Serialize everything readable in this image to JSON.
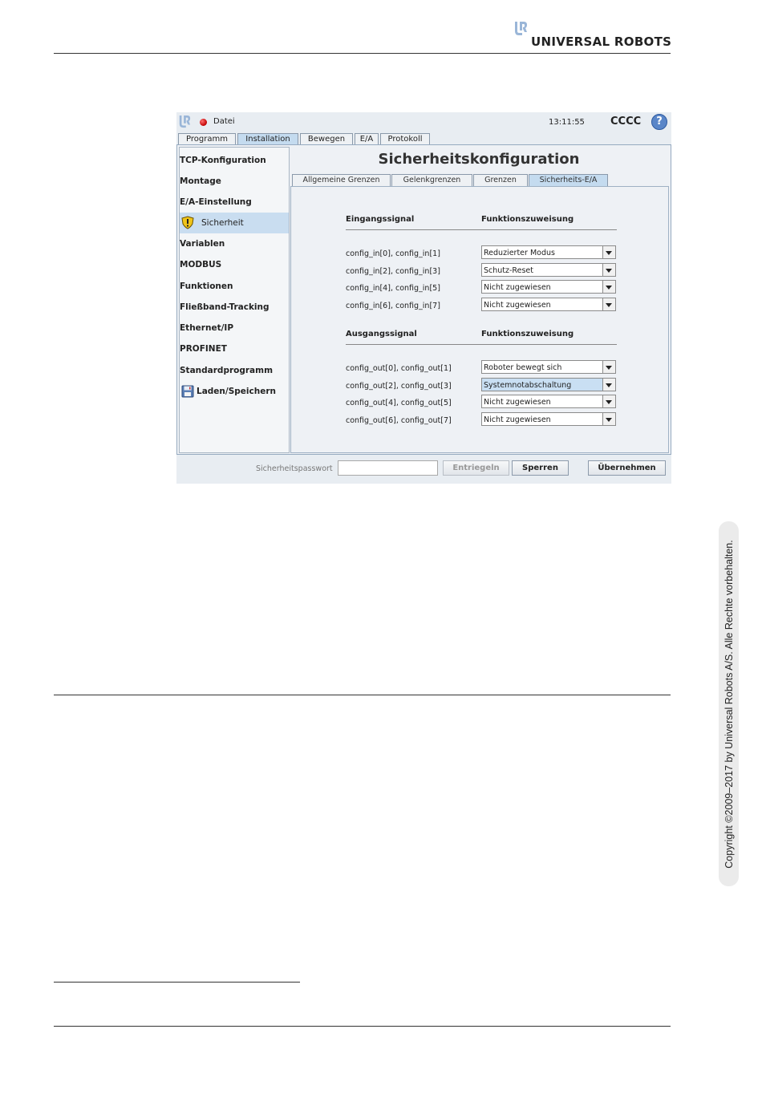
{
  "header": {
    "brand": "UNIVERSAL ROBOTS"
  },
  "copyright": "Copyright ©2009–2017 by Universal Robots A/S. Alle Rechte vorbehalten.",
  "app": {
    "topbar": {
      "file_menu": "Datei",
      "time": "13:11:55",
      "robot_name": "CCCC",
      "help_icon": "?"
    },
    "main_tabs": [
      {
        "label": "Programm",
        "active": false
      },
      {
        "label": "Installation",
        "active": true
      },
      {
        "label": "Bewegen",
        "active": false
      },
      {
        "label": "E/A",
        "active": false
      },
      {
        "label": "Protokoll",
        "active": false
      }
    ],
    "sidebar": [
      {
        "label": "TCP-Konfiguration"
      },
      {
        "label": "Montage"
      },
      {
        "label": "E/A-Einstellung"
      },
      {
        "label": "Sicherheit",
        "icon": "warning-shield-icon",
        "selected": true
      },
      {
        "label": "Variablen"
      },
      {
        "label": "MODBUS"
      },
      {
        "label": "Funktionen"
      },
      {
        "label": "Fließband-Tracking"
      },
      {
        "label": "Ethernet/IP"
      },
      {
        "label": "PROFINET"
      },
      {
        "label": "Standardprogramm"
      },
      {
        "label": "Laden/Speichern",
        "icon": "save-disk-icon"
      }
    ],
    "page_title": "Sicherheitskonfiguration",
    "sub_tabs": [
      {
        "label": "Allgemeine Grenzen",
        "active": false
      },
      {
        "label": "Gelenkgrenzen",
        "active": false
      },
      {
        "label": "Grenzen",
        "active": false
      },
      {
        "label": "Sicherheits-E/A",
        "active": true
      }
    ],
    "inputs": {
      "header_signal": "Eingangssignal",
      "header_function": "Funktionszuweisung",
      "rows": [
        {
          "signal": "config_in[0], config_in[1]",
          "value": "Reduzierter Modus",
          "highlighted": false
        },
        {
          "signal": "config_in[2], config_in[3]",
          "value": "Schutz-Reset",
          "highlighted": false
        },
        {
          "signal": "config_in[4], config_in[5]",
          "value": "Nicht zugewiesen",
          "highlighted": false
        },
        {
          "signal": "config_in[6], config_in[7]",
          "value": "Nicht zugewiesen",
          "highlighted": false
        }
      ]
    },
    "outputs": {
      "header_signal": "Ausgangssignal",
      "header_function": "Funktionszuweisung",
      "rows": [
        {
          "signal": "config_out[0], config_out[1]",
          "value": "Roboter bewegt sich",
          "highlighted": false
        },
        {
          "signal": "config_out[2], config_out[3]",
          "value": "Systemnotabschaltung",
          "highlighted": true
        },
        {
          "signal": "config_out[4], config_out[5]",
          "value": "Nicht zugewiesen",
          "highlighted": false
        },
        {
          "signal": "config_out[6], config_out[7]",
          "value": "Nicht zugewiesen",
          "highlighted": false
        }
      ]
    },
    "bottom": {
      "password_label": "Sicherheitspasswort",
      "password_value": "",
      "unlock_label": "Entriegeln",
      "lock_label": "Sperren",
      "apply_label": "Übernehmen"
    }
  }
}
